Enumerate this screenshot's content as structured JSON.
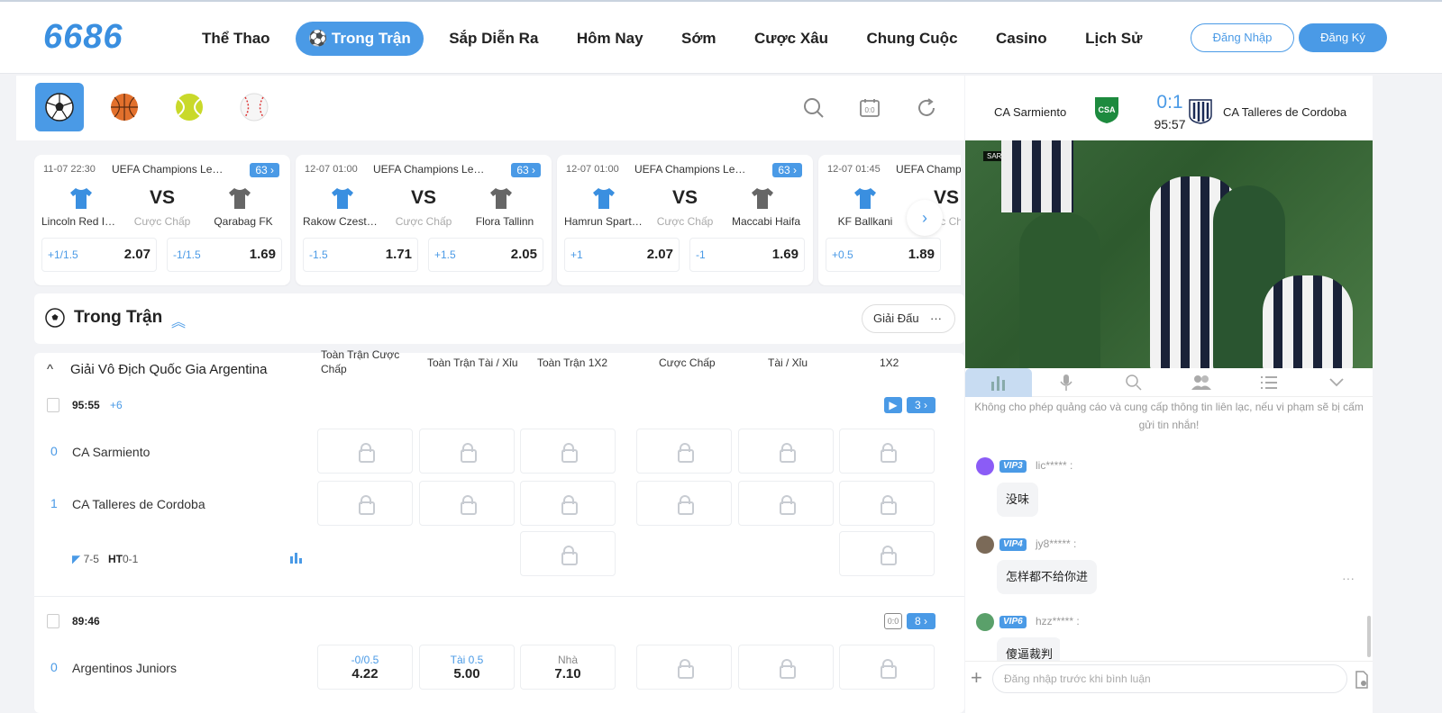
{
  "brand": {
    "logo": "6686"
  },
  "nav": {
    "items": [
      "Thể Thao",
      "⚽ Trong Trận",
      "Sắp Diễn Ra",
      "Hôm Nay",
      "Sớm",
      "Cược Xâu",
      "Chung Cuộc",
      "Casino",
      "Lịch Sử"
    ],
    "active_index": 1,
    "login": "Đăng Nhập",
    "register": "Đăng Ký"
  },
  "sports": [
    "soccer-ball-icon",
    "basketball-icon",
    "tennis-ball-icon",
    "baseball-icon"
  ],
  "cards": [
    {
      "time": "11-07 22:30",
      "league": "UEFA Champions League",
      "count": "63 ›",
      "vs": "VS",
      "team1": "Lincoln Red Imps",
      "team2": "Qarabag FK",
      "mid": "Cược Chấp",
      "h1": "+1/1.5",
      "o1": "2.07",
      "h2": "-1/1.5",
      "o2": "1.69"
    },
    {
      "time": "12-07 01:00",
      "league": "UEFA Champions League",
      "count": "63 ›",
      "vs": "VS",
      "team1": "Rakow Czestochowa",
      "team2": "Flora Tallinn",
      "mid": "Cược Chấp",
      "h1": "-1.5",
      "o1": "1.71",
      "h2": "+1.5",
      "o2": "2.05"
    },
    {
      "time": "12-07 01:00",
      "league": "UEFA Champions League",
      "count": "63 ›",
      "vs": "VS",
      "team1": "Hamrun Spartans",
      "team2": "Maccabi Haifa",
      "mid": "Cược Chấp",
      "h1": "+1",
      "o1": "2.07",
      "h2": "-1",
      "o2": "1.69"
    },
    {
      "time": "12-07 01:45",
      "league": "UEFA Champions League",
      "count": "63 ›",
      "vs": "VS",
      "team1": "KF Ballkani",
      "team2": "",
      "mid": "Cược Chấp",
      "h1": "+0.5",
      "o1": "1.89",
      "h2": "",
      "o2": ""
    }
  ],
  "section": {
    "title": "Trong Trận",
    "league_btn": "Giải Đấu",
    "dots": "···"
  },
  "table": {
    "league": "Giải Vô Địch Quốc Gia Argentina",
    "headers": [
      "Toàn Trận Cược Chấp",
      "Toàn Trận Tài / Xỉu",
      "Toàn Trận 1X2",
      "Cược Chấp",
      "Tài / Xỉu",
      "1X2"
    ],
    "match1": {
      "time": "95:55",
      "plus": "+6",
      "badge": "3 ›",
      "score1": "0",
      "team1": "CA Sarmiento",
      "score2": "1",
      "team2": "CA Talleres de Cordoba",
      "corners": "7-5",
      "ht_label": "HT",
      "ht": "0-1"
    },
    "match2": {
      "time": "89:46",
      "badge": "8 ›",
      "score1": "0",
      "team1": "Argentinos Juniors",
      "c1_label": "-0/0.5",
      "c1_val": "4.22",
      "c2_label": "Tài 0.5",
      "c2_val": "5.00",
      "c3_label": "Nhà",
      "c3_val": "7.10"
    }
  },
  "live": {
    "team1": "CA Sarmiento",
    "team2": "CA Talleres de Cordoba",
    "score": "0:1",
    "time": "95:57",
    "scoreboard": "SAR 0 1 TAL 95:31"
  },
  "chat": {
    "notice": "Không cho phép quảng cáo và cung cấp thông tin liên lạc, nếu vi phạm sẽ bị cấm gửi tin nhắn!",
    "messages": [
      {
        "vip": "VIP3",
        "user": "lic***** :",
        "text": "没味"
      },
      {
        "vip": "VIP4",
        "user": "jy8***** :",
        "text": "怎样都不给你进"
      },
      {
        "vip": "VIP6",
        "user": "hzz***** :",
        "text": "傻逼裁判"
      }
    ],
    "placeholder": "Đăng nhập trước khi bình luận"
  },
  "colors": {
    "accent": "#4a9ae6"
  }
}
